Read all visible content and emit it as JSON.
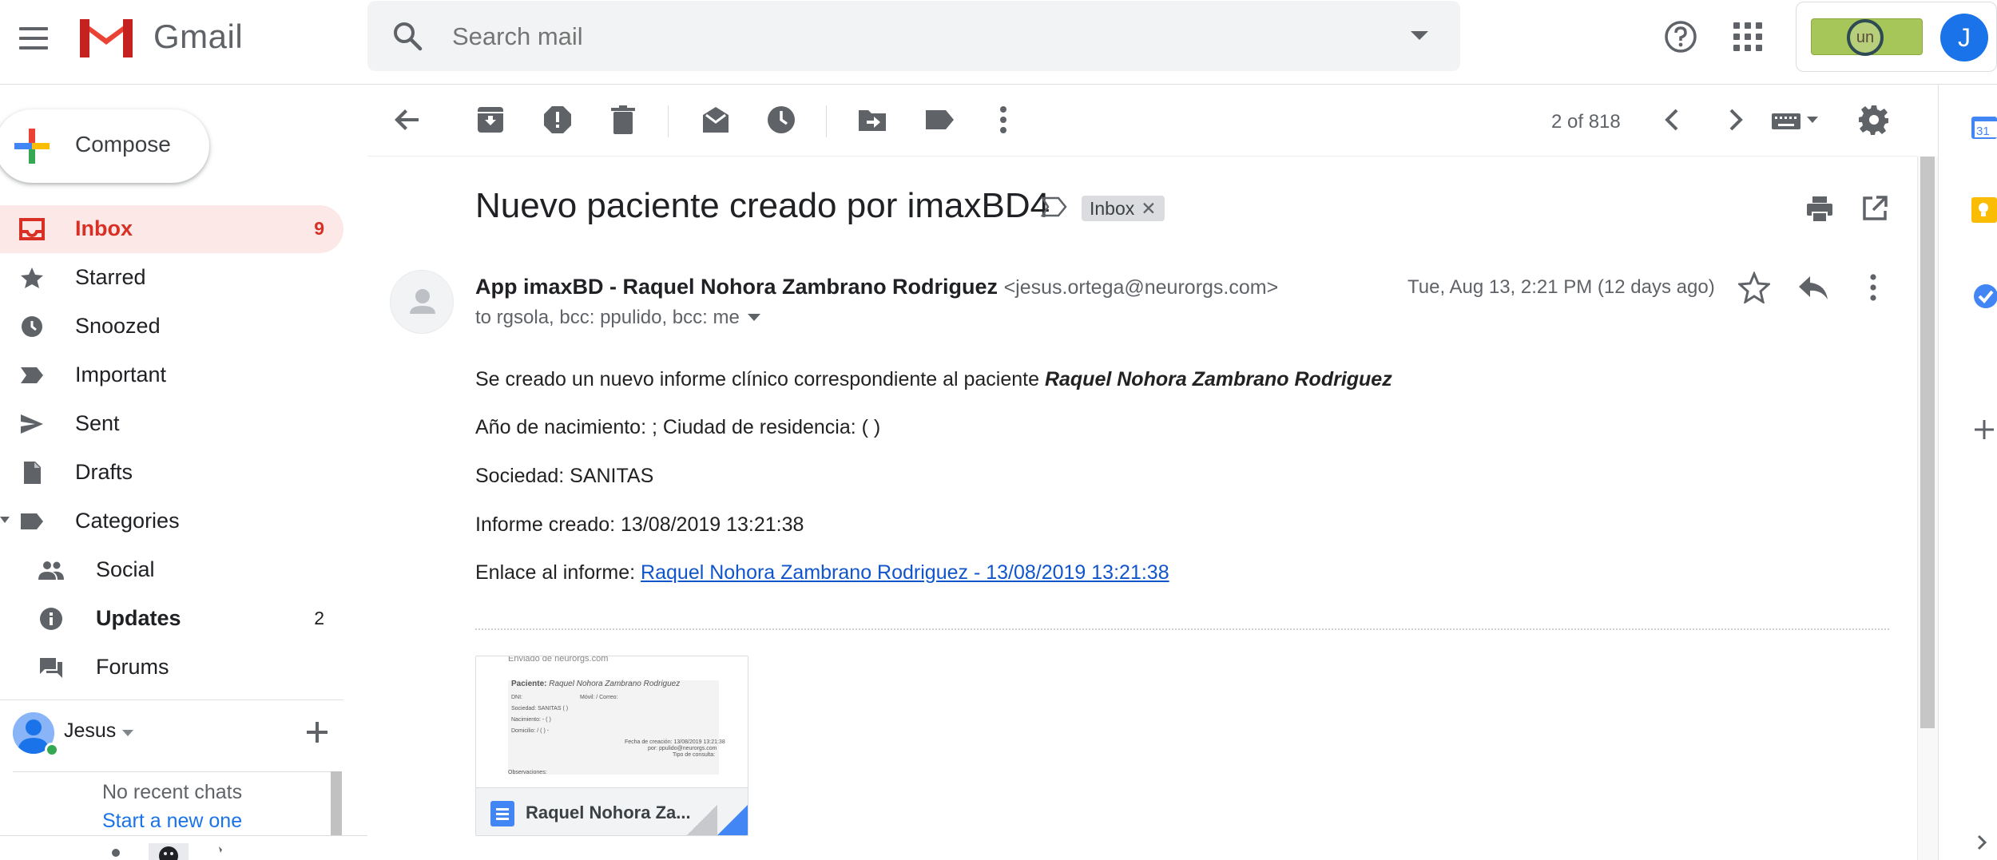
{
  "app": {
    "name": "Gmail"
  },
  "search": {
    "placeholder": "Search mail"
  },
  "account": {
    "initial": "J",
    "badge_text": "un"
  },
  "compose": {
    "label": "Compose"
  },
  "nav": {
    "items": [
      {
        "label": "Inbox",
        "count": "9"
      },
      {
        "label": "Starred",
        "count": ""
      },
      {
        "label": "Snoozed",
        "count": ""
      },
      {
        "label": "Important",
        "count": ""
      },
      {
        "label": "Sent",
        "count": ""
      },
      {
        "label": "Drafts",
        "count": ""
      },
      {
        "label": "Categories",
        "count": ""
      },
      {
        "label": "Social",
        "count": ""
      },
      {
        "label": "Updates",
        "count": "2"
      },
      {
        "label": "Forums",
        "count": ""
      }
    ]
  },
  "chat": {
    "user_name": "Jesus",
    "empty_text": "No recent chats",
    "start_link": "Start a new one"
  },
  "toolbar": {
    "pager": "2 of 818"
  },
  "message": {
    "subject": "Nuevo paciente creado por imaxBD4",
    "label_chip": "Inbox",
    "sender_name": "App imaxBD - Raquel Nohora Zambrano Rodriguez",
    "sender_email": "<jesus.ortega@neurorgs.com>",
    "recipients": "to rgsola, bcc: ppulido, bcc: me",
    "date": "Tue, Aug 13, 2:21 PM (12 days ago)",
    "body": {
      "line1_prefix": "Se creado un nuevo informe clínico correspondiente al paciente ",
      "line1_patient": "Raquel Nohora Zambrano Rodriguez",
      "line2": "Año de nacimiento: ; Ciudad de residencia: ( )",
      "line3": "Sociedad: SANITAS",
      "line4": "Informe creado: 13/08/2019 13:21:38",
      "line5_prefix": "Enlace al informe: ",
      "line5_link": "Raquel Nohora Zambrano Rodriguez - 13/08/2019 13:21:38"
    },
    "attachment": {
      "name": "Raquel Nohora Za...",
      "preview": {
        "header": "Enviado de neurorgs.com",
        "patient_label": "Paciente:",
        "patient_value": "Raquel Nohora Zambrano Rodriguez",
        "dni": "DNI:",
        "movil": "Móvil:",
        "correo": "/ Correo:",
        "sociedad": "Sociedad: SANITAS ( )",
        "nacimiento": "Nacimiento: - ( )",
        "domicilio": "Domicilio: / ( ) -",
        "fecha": "Fecha de creación: 13/08/2019 13:21:38",
        "por": "por: ppulido@neurorgs.com",
        "tipo": "Tipo de consulta:",
        "obs": "Observaciones:"
      }
    }
  },
  "colors": {
    "accent_red": "#d93025",
    "active_bg": "#fce8e6",
    "link_blue": "#1155cc",
    "avatar_blue": "#1a73e8"
  }
}
